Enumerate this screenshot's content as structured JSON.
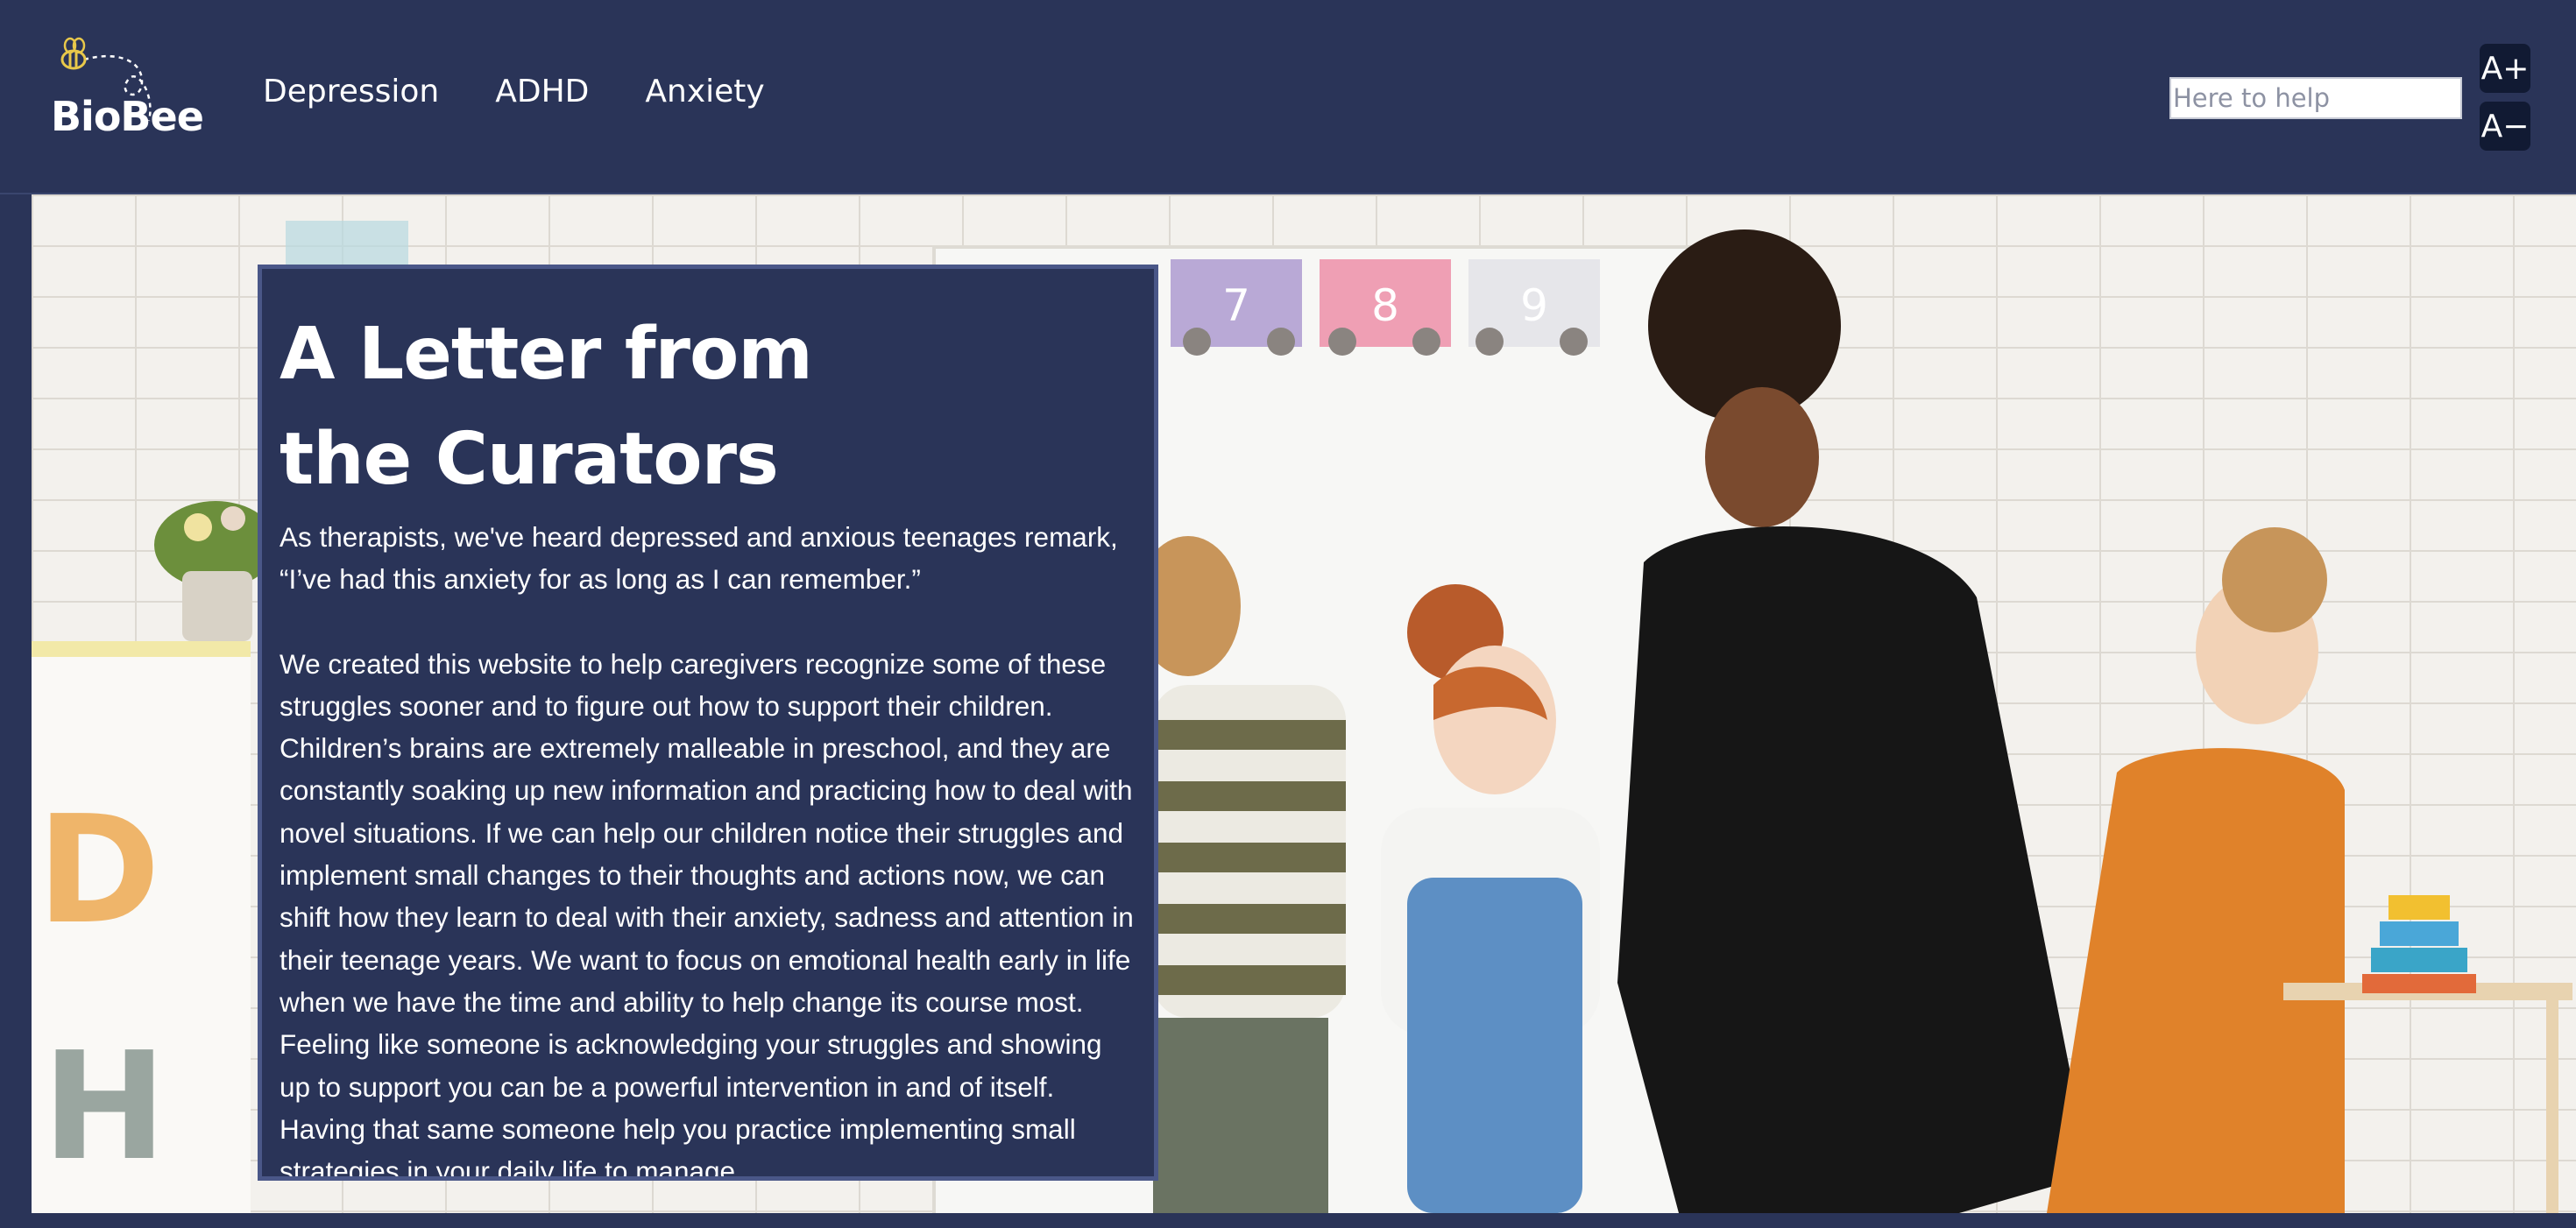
{
  "header": {
    "brand": "BioBee",
    "nav": [
      "Depression",
      "ADHD",
      "Anxiety"
    ],
    "search_placeholder": "Here to help",
    "font_increase_label": "A+",
    "font_decrease_label": "A−"
  },
  "hero": {
    "train_numbers": [
      "7",
      "8",
      "9"
    ],
    "wall_letters": [
      "D",
      "H"
    ]
  },
  "letter": {
    "title": "A Letter from the Curators",
    "paragraphs": [
      "As therapists, we've heard depressed and anxious teenages remark, “I’ve had this anxiety for as long as I can remember.”",
      "We created this website to help caregivers recognize some of these struggles sooner and to figure out how to support their children. Children’s brains are extremely malleable in preschool, and they are constantly soaking up new information and practicing how to deal with novel situations. If we can help our children notice their struggles and implement small changes to their thoughts and actions now, we can shift how they learn to deal with their anxiety, sadness and attention in their teenage years. We want to focus on emotional health early in life when we have the time and ability to help change its course most. Feeling like someone is acknowledging your struggles and showing up to support you can be a powerful intervention in and of itself. Having that same someone help you practice implementing small strategies in your daily life to manage"
    ]
  },
  "colors": {
    "navy": "#2a3458",
    "card_border": "#4a5788",
    "button_dark": "#111a33",
    "bee_yellow": "#e8c84a"
  },
  "icons": [
    "bee-icon",
    "flight-path-icon"
  ]
}
